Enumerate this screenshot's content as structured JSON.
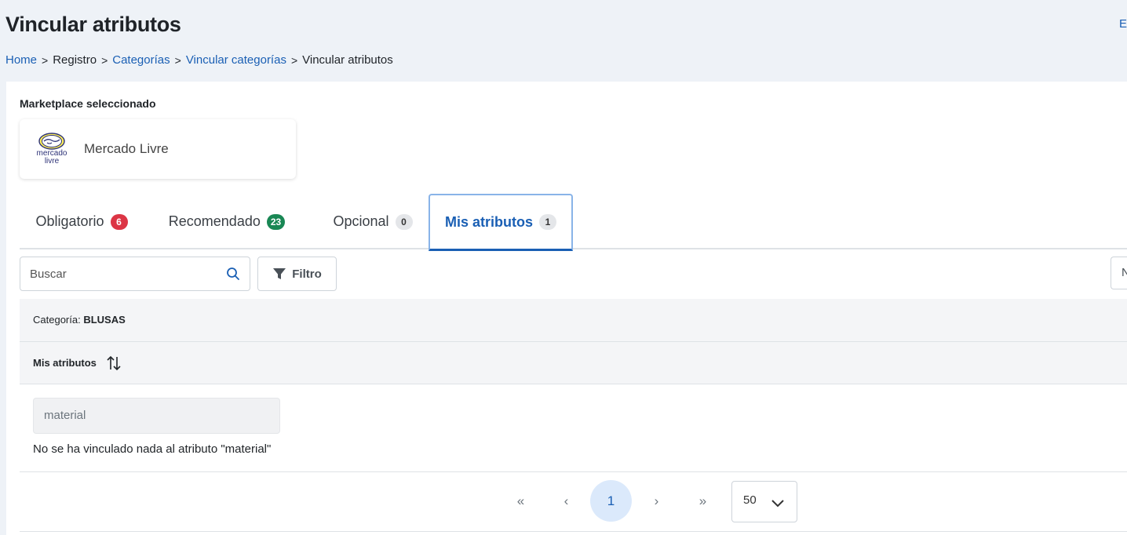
{
  "header": {
    "title": "Vincular atributos",
    "edge_link": "E",
    "breadcrumb": [
      {
        "label": "Home"
      },
      {
        "label": "Registro"
      },
      {
        "label": "Categorías"
      },
      {
        "label": "Vincular categorías"
      },
      {
        "label": "Vincular atributos"
      }
    ]
  },
  "marketplace": {
    "section_label": "Marketplace seleccionado",
    "logo_text_line1": "mercado",
    "logo_text_line2": "livre",
    "name": "Mercado Livre",
    "icon": "handshake-logo-icon"
  },
  "tabs": [
    {
      "label": "Obligatorio",
      "count": "6",
      "badge_color": "#dc3545"
    },
    {
      "label": "Recomendado",
      "count": "23",
      "badge_color": "#198754"
    },
    {
      "label": "Opcional",
      "count": "0",
      "badge_color": "#e4e6e9"
    },
    {
      "label": "Mis atributos",
      "count": "1",
      "badge_color": "#e4e6e9",
      "active": true
    }
  ],
  "toolbar": {
    "search_placeholder": "Buscar",
    "search_icon": "search-icon",
    "filter_label": "Filtro",
    "filter_icon": "funnel-icon",
    "right_control_text": "N"
  },
  "table": {
    "category_label": "Categoría:",
    "category_value": "BLUSAS",
    "column_header": "Mis atributos",
    "sort_icon": "sort-icon",
    "rows": [
      {
        "attribute": "material",
        "message": "No se ha vinculado nada al atributo \"material\""
      }
    ]
  },
  "pagination": {
    "first": "«",
    "prev": "‹",
    "current_page": "1",
    "next": "›",
    "last": "»",
    "page_size": "50"
  },
  "colors": {
    "accent": "#1a5fb4",
    "link": "#1a5fb4",
    "background": "#eef2f7"
  }
}
